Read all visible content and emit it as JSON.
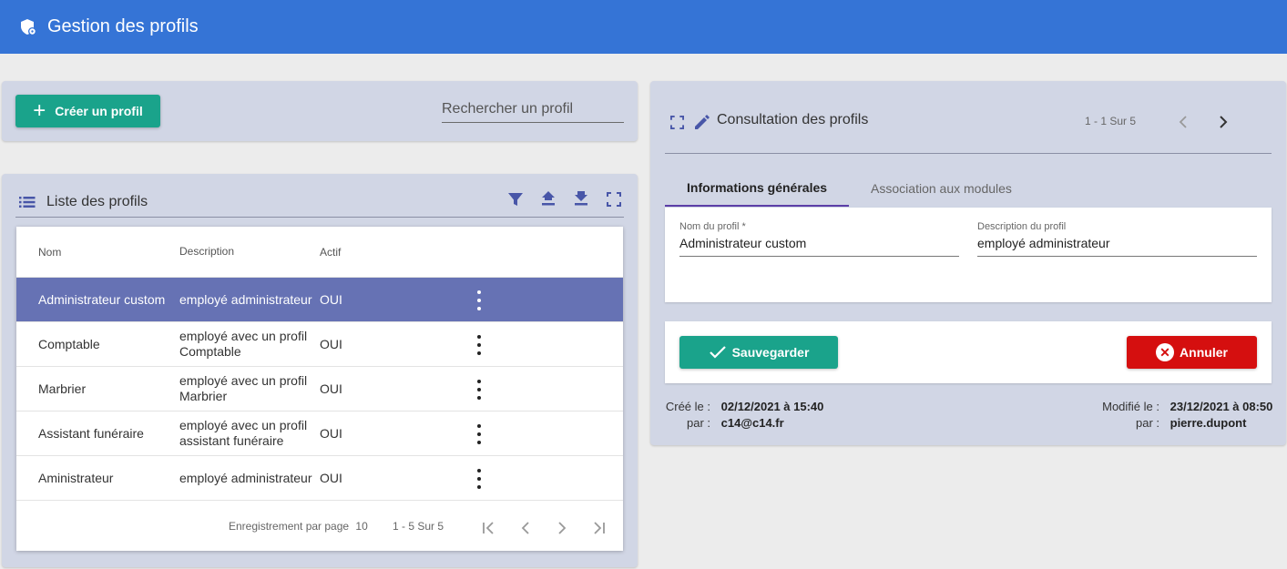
{
  "header": {
    "title": "Gestion des profils",
    "icon": "shield-gear-icon",
    "color": "#3574d6"
  },
  "create_panel": {
    "create_label": "Créer un profil",
    "search_placeholder": "Rechercher un profil"
  },
  "list": {
    "title": "Liste des profils",
    "columns": {
      "nom": "Nom",
      "description": "Description",
      "actif": "Actif"
    },
    "rows": [
      {
        "nom": "Administrateur custom",
        "description": "employé administrateur",
        "actif": "OUI"
      },
      {
        "nom": "Comptable",
        "description": "employé avec un profil Comptable",
        "actif": "OUI"
      },
      {
        "nom": "Marbrier",
        "description": "employé avec un profil Marbrier",
        "actif": "OUI"
      },
      {
        "nom": "Assistant funéraire",
        "description": "employé avec un profil assistant funéraire",
        "actif": "OUI"
      },
      {
        "nom": "Aministrateur",
        "description": "employé administrateur",
        "actif": "OUI"
      }
    ],
    "pager": {
      "per_page_label": "Enregistrement par page",
      "per_page": "10",
      "range": "1 - 5 Sur 5"
    },
    "selected_color": "#6672b4"
  },
  "view": {
    "title": "Consultation des profils",
    "range": "1 - 1 Sur 5",
    "tabs": [
      {
        "label": "Informations générales"
      },
      {
        "label": "Association aux modules"
      }
    ],
    "fields": {
      "nom": {
        "label": "Nom du profil *",
        "value": "Administrateur custom"
      },
      "description": {
        "label": "Description du profil",
        "value": "employé administrateur"
      }
    },
    "save_label": "Sauvegarder",
    "cancel_label": "Annuler",
    "created": {
      "label": "Créé le :",
      "date": "02/12/2021 à 15:40",
      "by_label": "par :",
      "by": "c14@c14.fr"
    },
    "modified": {
      "label": "Modifié le :",
      "date": "23/12/2021 à 08:50",
      "by_label": "par :",
      "by": "pierre.dupont"
    }
  },
  "colors": {
    "accent_green": "#1aa38b",
    "danger_red": "#d50f0f",
    "tab_underline": "#5c3ea7",
    "icon_blue": "#4856a8"
  }
}
